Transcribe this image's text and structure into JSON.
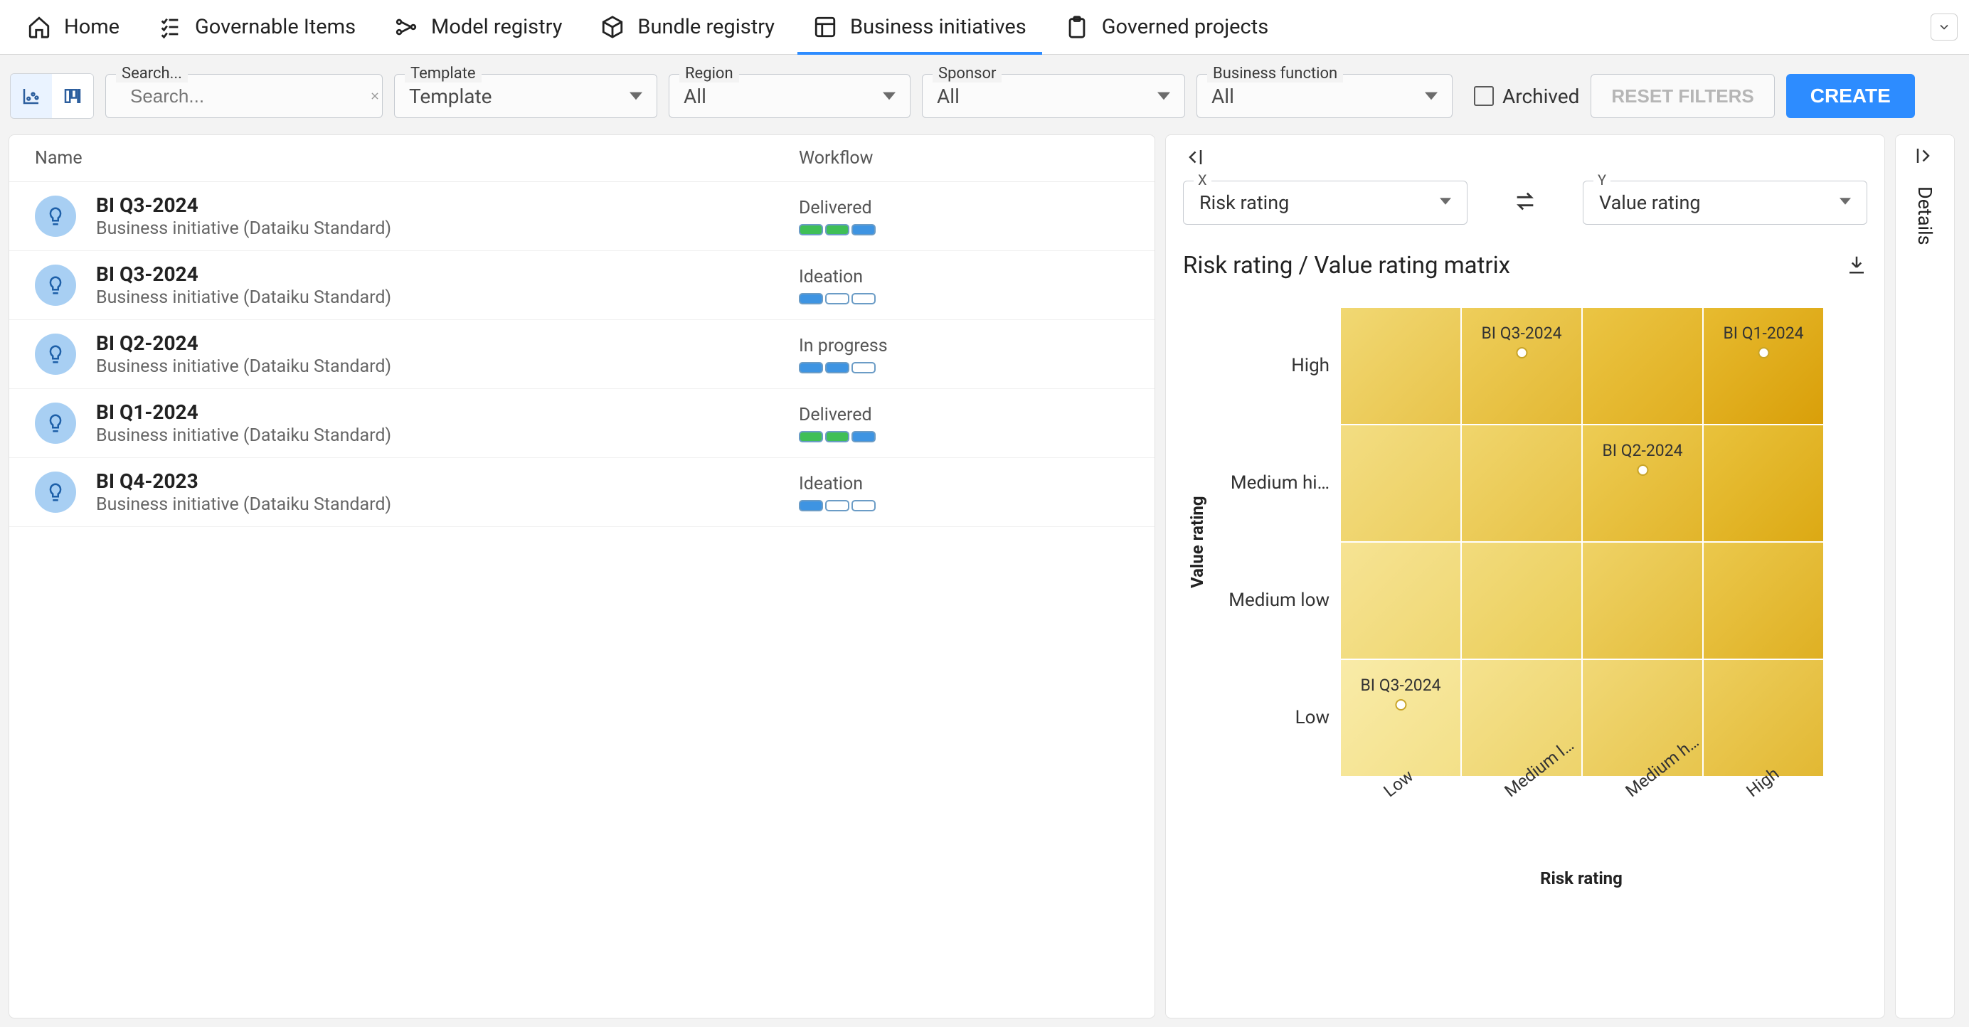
{
  "nav": {
    "tabs": [
      {
        "label": "Home"
      },
      {
        "label": "Governable Items"
      },
      {
        "label": "Model registry"
      },
      {
        "label": "Bundle registry"
      },
      {
        "label": "Business initiatives"
      },
      {
        "label": "Governed projects"
      }
    ],
    "activeIndex": 4
  },
  "filters": {
    "search": {
      "placeholder": "Search...",
      "value": ""
    },
    "template": {
      "label": "Template",
      "value": "Template"
    },
    "region": {
      "label": "Region",
      "value": "All"
    },
    "sponsor": {
      "label": "Sponsor",
      "value": "All"
    },
    "bizfn": {
      "label": "Business function",
      "value": "All"
    },
    "archived": {
      "label": "Archived",
      "checked": false
    },
    "reset": "RESET FILTERS",
    "create": "CREATE"
  },
  "list": {
    "columns": {
      "name": "Name",
      "workflow": "Workflow"
    },
    "rows": [
      {
        "title": "BI Q3-2024",
        "subtitle": "Business initiative (Dataiku Standard)",
        "status": "Delivered",
        "segs": [
          "green",
          "green",
          "blue"
        ]
      },
      {
        "title": "BI Q3-2024",
        "subtitle": "Business initiative (Dataiku Standard)",
        "status": "Ideation",
        "segs": [
          "blue",
          "empty",
          "empty"
        ]
      },
      {
        "title": "BI Q2-2024",
        "subtitle": "Business initiative (Dataiku Standard)",
        "status": "In progress",
        "segs": [
          "blue",
          "blue",
          "empty"
        ]
      },
      {
        "title": "BI Q1-2024",
        "subtitle": "Business initiative (Dataiku Standard)",
        "status": "Delivered",
        "segs": [
          "green",
          "green",
          "blue"
        ]
      },
      {
        "title": "BI Q4-2023",
        "subtitle": "Business initiative (Dataiku Standard)",
        "status": "Ideation",
        "segs": [
          "blue",
          "empty",
          "empty"
        ]
      }
    ]
  },
  "matrix": {
    "x": {
      "label": "X",
      "value": "Risk rating"
    },
    "y": {
      "label": "Y",
      "value": "Value rating"
    },
    "title": "Risk rating / Value rating matrix",
    "xlabel": "Risk rating",
    "ylabel": "Value rating",
    "yticks": [
      "High",
      "Medium hi…",
      "Medium low",
      "Low"
    ],
    "xticks": [
      "Low",
      "Medium low",
      "Medium hi…",
      "High"
    ],
    "points": [
      {
        "label": "BI Q3-2024",
        "row": 0,
        "col": 1
      },
      {
        "label": "BI Q1-2024",
        "row": 0,
        "col": 3
      },
      {
        "label": "BI Q2-2024",
        "row": 1,
        "col": 2
      },
      {
        "label": "BI Q3-2024",
        "row": 3,
        "col": 0
      }
    ]
  },
  "details": {
    "label": "Details"
  },
  "chart_data": {
    "type": "heatmap",
    "title": "Risk rating / Value rating matrix",
    "xlabel": "Risk rating",
    "ylabel": "Value rating",
    "x_categories": [
      "Low",
      "Medium low",
      "Medium high",
      "High"
    ],
    "y_categories": [
      "Low",
      "Medium low",
      "Medium high",
      "High"
    ],
    "series": [
      {
        "name": "BI Q3-2024",
        "x": "Medium low",
        "y": "High"
      },
      {
        "name": "BI Q1-2024",
        "x": "High",
        "y": "High"
      },
      {
        "name": "BI Q2-2024",
        "x": "Medium high",
        "y": "Medium high"
      },
      {
        "name": "BI Q3-2024",
        "x": "Low",
        "y": "Low"
      }
    ]
  }
}
